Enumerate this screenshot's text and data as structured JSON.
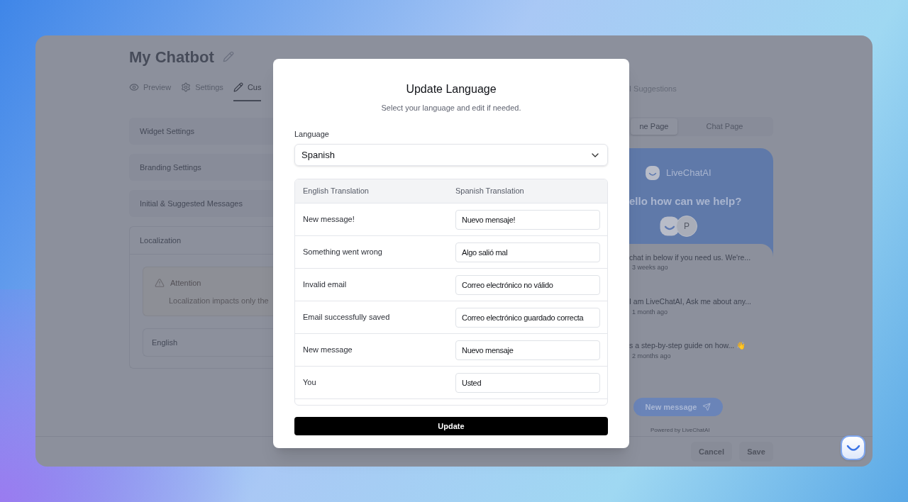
{
  "page": {
    "title": "My Chatbot",
    "tabs": [
      {
        "label": "Preview",
        "kind": "eye",
        "selected": false
      },
      {
        "label": "Settings",
        "kind": "gear",
        "selected": false
      },
      {
        "label": "Cus",
        "kind": "pencil",
        "selected": true
      }
    ],
    "tabs_right": [
      {
        "label": "I Suggestions",
        "selected": false
      }
    ],
    "sections": [
      {
        "title": "Widget Settings",
        "expanded": false
      },
      {
        "title": "Branding Settings",
        "expanded": false
      },
      {
        "title": "Initial & Suggested Messages",
        "expanded": false
      },
      {
        "title": "Localization",
        "expanded": true
      }
    ],
    "attention": {
      "title": "Attention",
      "text": "Localization impacts only the"
    },
    "language_row": "English",
    "preview_tabs": [
      {
        "label": "ne Page",
        "selected": true
      },
      {
        "label": "Chat Page",
        "selected": false
      }
    ],
    "preview": {
      "brand": "LiveChatAI",
      "heading": "ello how can we help?",
      "avatar_letter": "P",
      "messages": [
        {
          "text": "chat in below if you need us. We're...",
          "time": "3 weeks ago"
        },
        {
          "text": "I am LiveChatAI, Ask me about any...",
          "time": "1 month ago"
        },
        {
          "text": "s a step-by-step guide on how... 👋",
          "time": "2 months ago"
        }
      ],
      "button": "New message",
      "footer": "Powered by LiveChatAI"
    },
    "buttons": [
      "Cancel",
      "Save"
    ]
  },
  "dialog": {
    "title": "Update Language",
    "subtitle": "Select your language and edit if needed.",
    "language_label": "Language",
    "language": "Spanish",
    "columns": [
      "English Translation",
      "Spanish Translation"
    ],
    "rows": [
      {
        "english": "New message!",
        "translation": "Nuevo mensaje!"
      },
      {
        "english": "Something went wrong",
        "translation": "Algo salió mal"
      },
      {
        "english": "Invalid email",
        "translation": "Correo electrónico no válido"
      },
      {
        "english": "Email successfully saved",
        "translation": "Correo electrónico guardado correcta"
      },
      {
        "english": "New message",
        "translation": "Nuevo mensaje"
      },
      {
        "english": "You",
        "translation": "Usted"
      }
    ],
    "button": "Update"
  }
}
